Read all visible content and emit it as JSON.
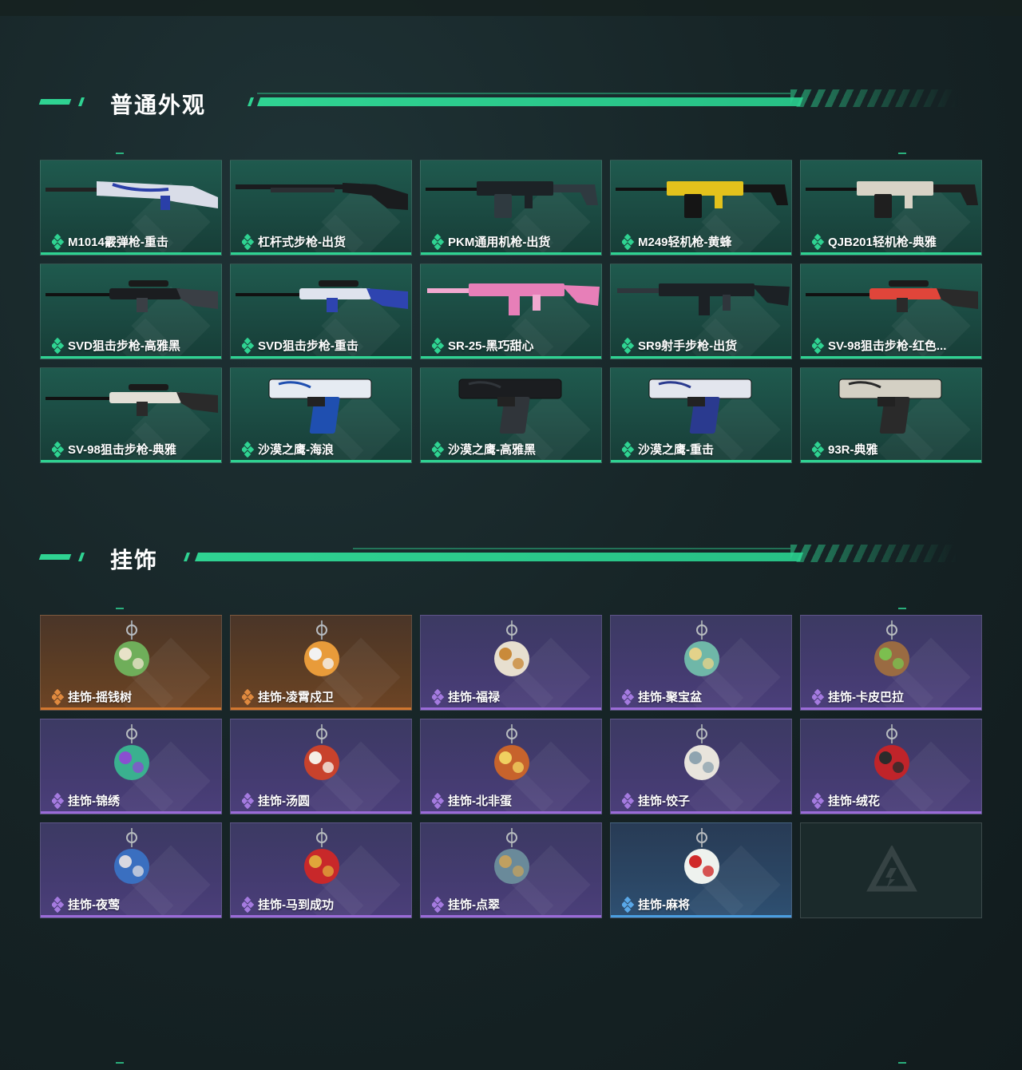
{
  "sections": {
    "skins": {
      "title": "普通外观"
    },
    "charms": {
      "title": "挂饰"
    }
  },
  "skins": [
    {
      "name": "M1014霰弹枪-重击",
      "rarity": "green",
      "art": "shotgun",
      "colors": [
        "#d9dde8",
        "#2a3fa8"
      ]
    },
    {
      "name": "杠杆式步枪-出货",
      "rarity": "green",
      "art": "rifle",
      "colors": [
        "#1a1c1e",
        "#2b2f33"
      ]
    },
    {
      "name": "PKM通用机枪-出货",
      "rarity": "green",
      "art": "mg",
      "colors": [
        "#1c2226",
        "#2f3a40"
      ]
    },
    {
      "name": "M249轻机枪-黄蜂",
      "rarity": "green",
      "art": "mg",
      "colors": [
        "#e3c21c",
        "#151515"
      ]
    },
    {
      "name": "QJB201轻机枪-典雅",
      "rarity": "green",
      "art": "mg",
      "colors": [
        "#d8d3c6",
        "#1f1f1f"
      ]
    },
    {
      "name": "SVD狙击步枪-高雅黑",
      "rarity": "green",
      "art": "sniper",
      "colors": [
        "#1b1d20",
        "#3a3f45"
      ]
    },
    {
      "name": "SVD狙击步枪-重击",
      "rarity": "green",
      "art": "sniper",
      "colors": [
        "#dfe3ee",
        "#2e44b0"
      ]
    },
    {
      "name": "SR-25-黑巧甜心",
      "rarity": "green",
      "art": "ar",
      "colors": [
        "#e77fb8",
        "#f2a9d0"
      ]
    },
    {
      "name": "SR9射手步枪-出货",
      "rarity": "green",
      "art": "ar",
      "colors": [
        "#1c2125",
        "#2f363c"
      ]
    },
    {
      "name": "SV-98狙击步枪-红色...",
      "rarity": "green",
      "art": "sniper",
      "colors": [
        "#e0453a",
        "#2a2a2a"
      ]
    },
    {
      "name": "SV-98狙击步枪-典雅",
      "rarity": "green",
      "art": "sniper",
      "colors": [
        "#e2dfd6",
        "#2a2a2a"
      ]
    },
    {
      "name": "沙漠之鹰-海浪",
      "rarity": "green",
      "art": "pistol",
      "colors": [
        "#e6ebf2",
        "#1f4fb0"
      ]
    },
    {
      "name": "沙漠之鹰-高雅黑",
      "rarity": "green",
      "art": "pistol",
      "colors": [
        "#1b1d20",
        "#30353a"
      ]
    },
    {
      "name": "沙漠之鹰-重击",
      "rarity": "green",
      "art": "pistol",
      "colors": [
        "#e3e6ee",
        "#2a3a8f"
      ]
    },
    {
      "name": "93R-典雅",
      "rarity": "green",
      "art": "pistol2",
      "colors": [
        "#d4d0c4",
        "#2a2a2a"
      ]
    }
  ],
  "charms": [
    {
      "name": "挂饰-摇钱树",
      "rarity": "orange",
      "colors": [
        "#6fae5a",
        "#e8e2c8"
      ]
    },
    {
      "name": "挂饰-凌霄戍卫",
      "rarity": "orange",
      "colors": [
        "#e89b3a",
        "#f2f2f2"
      ]
    },
    {
      "name": "挂饰-福禄",
      "rarity": "purple",
      "colors": [
        "#e7dfcf",
        "#c98a3a"
      ]
    },
    {
      "name": "挂饰-聚宝盆",
      "rarity": "purple",
      "colors": [
        "#6fb7a8",
        "#e3d28a"
      ]
    },
    {
      "name": "挂饰-卡皮巴拉",
      "rarity": "purple",
      "colors": [
        "#9a6b42",
        "#7cbf4f"
      ]
    },
    {
      "name": "挂饰-锦绣",
      "rarity": "purple",
      "colors": [
        "#3ab08f",
        "#8a4fd0"
      ]
    },
    {
      "name": "挂饰-汤圆",
      "rarity": "purple",
      "colors": [
        "#c8422c",
        "#f5efe6"
      ]
    },
    {
      "name": "挂饰-北非蛋",
      "rarity": "purple",
      "colors": [
        "#c7632c",
        "#f0d060"
      ]
    },
    {
      "name": "挂饰-饺子",
      "rarity": "purple",
      "colors": [
        "#e8e4dc",
        "#8fa4b0"
      ]
    },
    {
      "name": "挂饰-绒花",
      "rarity": "purple",
      "colors": [
        "#c0242a",
        "#2b2b2b"
      ]
    },
    {
      "name": "挂饰-夜莺",
      "rarity": "purple",
      "colors": [
        "#3a6fc0",
        "#d8d8e0"
      ]
    },
    {
      "name": "挂饰-马到成功",
      "rarity": "purple",
      "colors": [
        "#c8282a",
        "#e0a53a"
      ]
    },
    {
      "name": "挂饰-点翠",
      "rarity": "purple",
      "colors": [
        "#6a8a9a",
        "#c0a060"
      ]
    },
    {
      "name": "挂饰-麻将",
      "rarity": "blue",
      "colors": [
        "#eef2ee",
        "#d02a2a"
      ]
    }
  ],
  "empty_slot_icon": "logo-placeholder-icon",
  "colors": {
    "accent": "#2fd392"
  }
}
